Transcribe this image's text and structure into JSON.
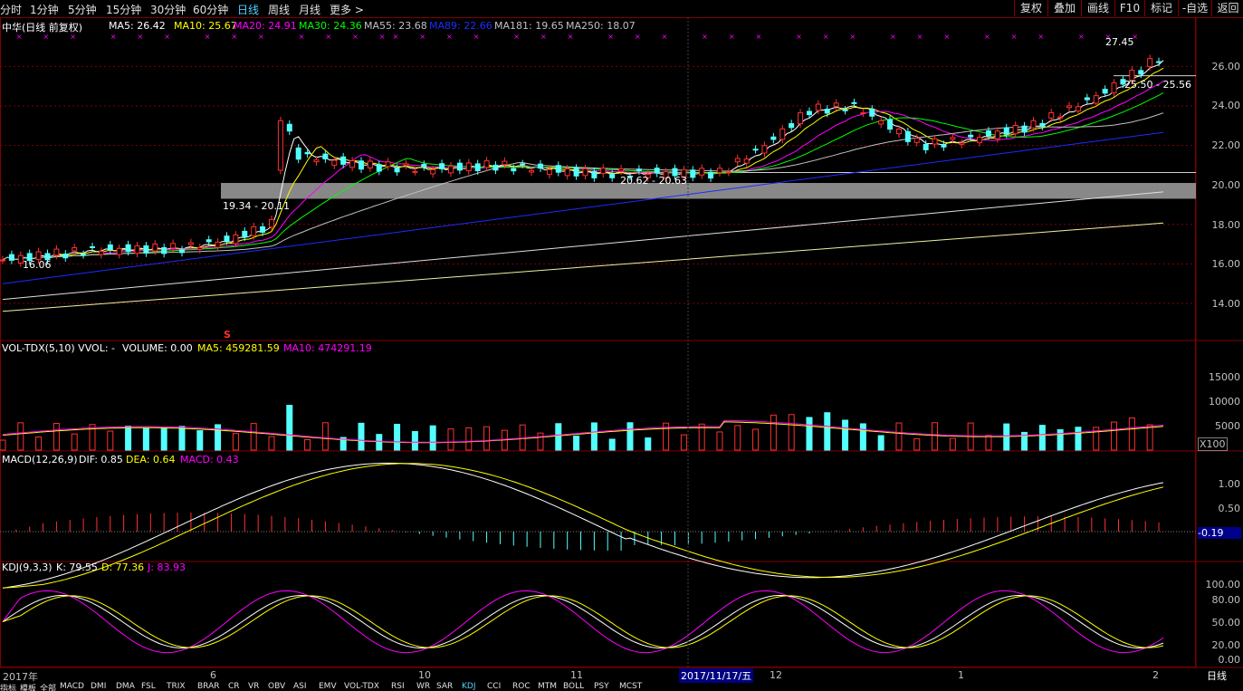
{
  "toolbar": {
    "timeframes": [
      "分时",
      "1分钟",
      "5分钟",
      "15分钟",
      "30分钟",
      "60分钟",
      "日线",
      "周线",
      "月线",
      "更多 >"
    ],
    "active": "日线",
    "right_buttons": [
      "复权",
      "叠加",
      "画线",
      "F10",
      "标记",
      "-自选",
      "返回"
    ]
  },
  "main_panel": {
    "title": "中华(日线 前复权)",
    "mas": [
      {
        "label": "MA5: 26.42",
        "color": "#ffffff"
      },
      {
        "label": "MA10: 25.67",
        "color": "#ffff00"
      },
      {
        "label": "MA20: 24.91",
        "color": "#ff00ff"
      },
      {
        "label": "MA30: 24.36",
        "color": "#00ff00"
      },
      {
        "label": "MA55: 23.68",
        "color": "#c0c0c0"
      },
      {
        "label": "MA89: 22.66",
        "color": "#1c2cff"
      },
      {
        "label": "MA181: 19.65",
        "color": "#c0c0c0"
      },
      {
        "label": "MA250: 18.07",
        "color": "#c0c0c0"
      }
    ],
    "yticks": [
      "26.00",
      "24.00",
      "22.00",
      "20.00",
      "18.00",
      "16.00",
      "14.00"
    ],
    "annotations": {
      "high": "27.45",
      "last_range": "25.50 - 25.56",
      "band": "20.62 - 20.63",
      "left_range": "19.34 - 20.11",
      "low": "16.06",
      "marker": "S"
    }
  },
  "vol_panel": {
    "title": "VOL-TDX(5,10) VVOL: -",
    "volume": "VOLUME: 0.00",
    "ma5": "MA5: 459281.59",
    "ma10": "MA10: 474291.19",
    "yticks": [
      "15000",
      "10000",
      "5000"
    ],
    "unit": "X100"
  },
  "macd_panel": {
    "title": "MACD(12,26,9)",
    "dif": "DIF: 0.85",
    "dea": "DEA: 0.64",
    "macd": "MACD: 0.43",
    "yticks": [
      "1.00",
      "0.50"
    ],
    "current": "-0.19"
  },
  "kdj_panel": {
    "title": "KDJ(9,3,3)",
    "k": "K: 79.55",
    "d": "D: 77.36",
    "j": "J: 83.93",
    "yticks": [
      "100.00",
      "80.00",
      "50.00",
      "20.00",
      "0.00"
    ]
  },
  "xaxis": {
    "labels": [
      "2017年",
      "6",
      "10",
      "11",
      "12",
      "1",
      "2"
    ],
    "cursor_date": "2017/11/17/五",
    "period": "日线"
  },
  "bottom_tabs": [
    "指标",
    "模板",
    "全部",
    "MACD",
    "DMI",
    "DMA",
    "FSL",
    "TRIX",
    "BRAR",
    "CR",
    "VR",
    "OBV",
    "ASI",
    "EMV",
    "VOL-TDX",
    "RSI",
    "WR",
    "SAR",
    "KDJ",
    "CCI",
    "ROC",
    "MTM",
    "BOLL",
    "PSY",
    "MCST"
  ],
  "bottom_active": "KDJ",
  "colors": {
    "up": "#ff3030",
    "down": "#54ffff",
    "grid": "#800000",
    "accent": "#4fd0ff"
  }
}
